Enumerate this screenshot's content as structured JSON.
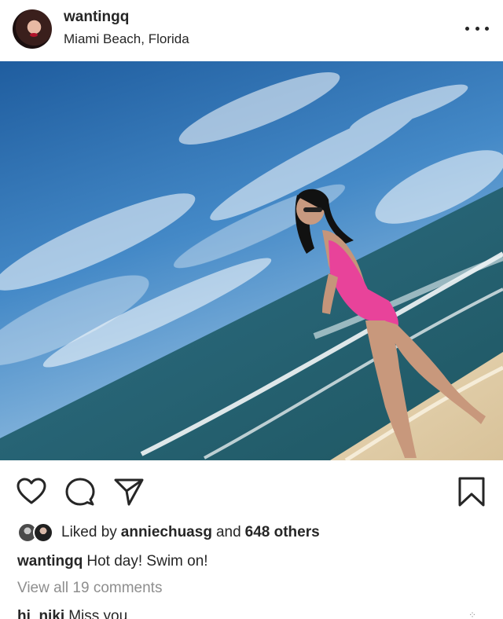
{
  "post": {
    "username": "wantingq",
    "location": "Miami Beach, Florida"
  },
  "icons": {
    "more": "more-options-icon",
    "like": "heart-icon",
    "comment": "comment-bubble-icon",
    "share": "send-paper-plane-icon",
    "save": "bookmark-icon"
  },
  "likes": {
    "prefix": "Liked by",
    "first_liker": "anniechuasg",
    "conjunction": "and",
    "others": "648 others"
  },
  "caption": {
    "username": "wantingq",
    "text": "Hot day! Swim on!"
  },
  "comments": {
    "view_all": "View all 19 comments",
    "first": {
      "username": "hi_niki",
      "text": "Miss you"
    }
  },
  "colors": {
    "text": "#262626",
    "secondary_text": "#8e8e8e",
    "swimsuit": "#e8439a",
    "sky": "#3a7fc0",
    "sea": "#2c6a79"
  }
}
